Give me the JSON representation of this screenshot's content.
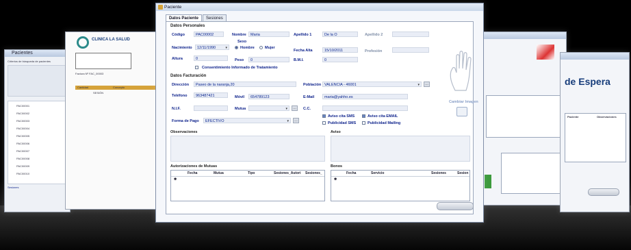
{
  "window": {
    "title": "Paciente"
  },
  "tabs": [
    "Datos Paciente",
    "Sesiones"
  ],
  "personal": {
    "section": "Datos Personales",
    "codigo_label": "Código",
    "codigo": "PAC00002",
    "nombre_label": "Nombre",
    "nombre": "Maria",
    "apellido1_label": "Apellido 1",
    "apellido1": "De la O",
    "apellido2_label": "Apellido 2",
    "sexo_label": "Sexo",
    "sexo_hombre": "Hombre",
    "sexo_mujer": "Mujer",
    "nacimiento_label": "Nacimiento",
    "nacimiento": "12/11/1990",
    "fecha_alta_label": "Fecha Alta",
    "fecha_alta": "15/10/2011",
    "profesion_label": "Profesión",
    "altura_label": "Altura",
    "altura": "0",
    "peso_label": "Peso",
    "peso": "0",
    "bmi_label": "B.M.I.",
    "bmi": "0",
    "consentimiento": "Consentimiento Informado de Tratamiento"
  },
  "facturacion": {
    "section": "Datos Facturación",
    "direccion_label": "Dirección",
    "direccion": "Paseo de la naranja,20",
    "poblacion_label": "Población",
    "poblacion": "VALENCIA - 46001",
    "telefono_label": "Teléfono",
    "telefono": "963487421",
    "movil_label": "Móvil",
    "movil": "654789123",
    "email_label": "E-Mail",
    "email": "maria@yahho.es",
    "nif_label": "N.I.F.",
    "mutua_label": "Mutua",
    "cc_label": "C.C.",
    "forma_pago_label": "Forma de Pago",
    "forma_pago": "EFECTIVO",
    "aviso_sms": "Aviso cita SMS",
    "aviso_email": "Aviso cita EMAIL",
    "publicidad_sms": "Publicidad SMS",
    "publicidad_mailing": "Publicidad Mailing",
    "cambiar_imagen": "Cambiar Imagen"
  },
  "observaciones_label": "Observaciones",
  "aviso_label": "Aviso",
  "autorizaciones": {
    "title": "Autorizaciones de Mutuas",
    "columns": [
      "Fecha",
      "Mutua",
      "Tipo",
      "Sesiones_Autori",
      "Sesiones_"
    ]
  },
  "bonos": {
    "title": "Bonos",
    "columns": [
      "Fecha",
      "Servicio",
      "Sesiones",
      "Sesion"
    ]
  },
  "w1": {
    "title": "Pacientes",
    "header": "Criterios de búsqueda de pacientes",
    "codes": [
      "PAC00001",
      "PAC00002",
      "PAC00003",
      "PAC00004",
      "PAC00005",
      "PAC00006",
      "PAC00007",
      "PAC00008",
      "PAC00009",
      "PAC00010"
    ],
    "footer": "Sesiones"
  },
  "w2": {
    "clinic": "CLINICA LA SALUD",
    "factura": "Factura Nº FAC_00003",
    "col1": "Cantidad",
    "col2": "Concepto",
    "row": "SESIÓN"
  },
  "w4": {
    "title": "de Espera",
    "col1": "Paciente",
    "col2": "Observaciones"
  },
  "colors": {
    "label": "#0a1f8a",
    "accent": "#6a86c6"
  }
}
